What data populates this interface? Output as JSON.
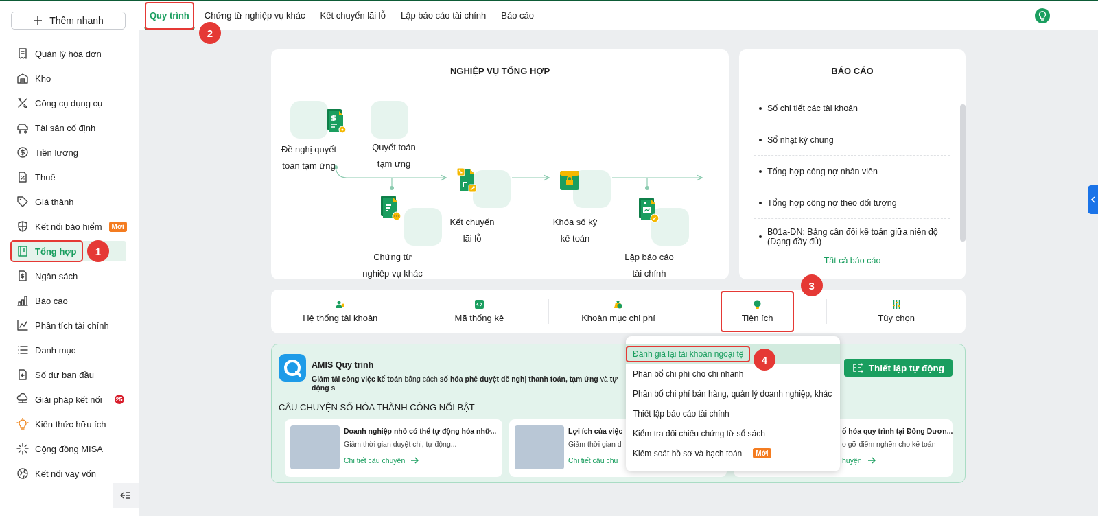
{
  "sidebar": {
    "quick_add": "Thêm nhanh",
    "items": [
      {
        "label": "Quản lý hóa đơn",
        "selected": false,
        "framed": false
      },
      {
        "label": "Kho",
        "selected": false,
        "framed": false
      },
      {
        "label": "Công cụ dụng cụ",
        "selected": false,
        "framed": false
      },
      {
        "label": "Tài sản cố định",
        "selected": false,
        "framed": false
      },
      {
        "label": "Tiền lương",
        "selected": false,
        "framed": false
      },
      {
        "label": "Thuế",
        "selected": false,
        "framed": false
      },
      {
        "label": "Giá thành",
        "selected": false,
        "framed": false
      },
      {
        "label": "Kết nối bảo hiểm",
        "selected": false,
        "framed": false,
        "badge": {
          "kind": "new",
          "text": "Mới"
        }
      },
      {
        "label": "Tổng hợp",
        "selected": true,
        "framed": true,
        "callout": "1"
      },
      {
        "label": "Ngân sách",
        "selected": false,
        "framed": false
      },
      {
        "label": "Báo cáo",
        "selected": false,
        "framed": false
      },
      {
        "label": "Phân tích tài chính",
        "selected": false,
        "framed": false
      },
      {
        "label": "Danh mục",
        "selected": false,
        "framed": false
      },
      {
        "label": "Số dư ban đầu",
        "selected": false,
        "framed": false
      },
      {
        "label": "Giải pháp kết nối",
        "selected": false,
        "framed": false,
        "badge": {
          "kind": "count",
          "text": "25"
        }
      },
      {
        "label": "Kiến thức hữu ích",
        "selected": false,
        "framed": false
      },
      {
        "label": "Cộng đồng MISA",
        "selected": false,
        "framed": false
      },
      {
        "label": "Kết nối vay vốn",
        "selected": false,
        "framed": false
      }
    ]
  },
  "tabs": [
    {
      "label": "Quy trình",
      "selected": true,
      "framed": true,
      "callout": "2"
    },
    {
      "label": "Chứng từ nghiệp vụ khác",
      "selected": false,
      "framed": false
    },
    {
      "label": "Kết chuyển lãi lỗ",
      "selected": false,
      "framed": false
    },
    {
      "label": "Lập báo cáo tài chính",
      "selected": false,
      "framed": false
    },
    {
      "label": "Báo cáo",
      "selected": false,
      "framed": false
    }
  ],
  "process": {
    "title": "NGHIỆP VỤ TỔNG HỢP",
    "steps": [
      {
        "label": "Đề nghị quyết\ntoán tạm ứng"
      },
      {
        "label": "Quyết toán\ntạm ứng"
      },
      {
        "label": "Chứng từ\nnghiệp vụ khác"
      },
      {
        "label": "Kết chuyển\nlãi lỗ"
      },
      {
        "label": "Khóa sổ kỳ\nkế toán"
      },
      {
        "label": "Lập báo cáo\ntài chính"
      }
    ]
  },
  "reports": {
    "title": "BÁO CÁO",
    "items": [
      "Sổ chi tiết các tài khoản",
      "Sổ nhật ký chung",
      "Tổng hợp công nợ nhân viên",
      "Tổng hợp công nợ theo đối tượng",
      "B01a-DN: Bảng cân đối kế toán giữa niên độ (Dạng đầy đủ)"
    ],
    "all_link": "Tất cả báo cáo"
  },
  "tools": [
    {
      "label": "Hệ thống tài khoản",
      "framed": false
    },
    {
      "label": "Mã thống kê",
      "framed": false
    },
    {
      "label": "Khoản mục chi phí",
      "framed": false
    },
    {
      "label": "Tiện ích",
      "framed": true,
      "callout": "3"
    },
    {
      "label": "Tùy chọn",
      "framed": false
    }
  ],
  "dropdown": {
    "items": [
      {
        "label": "Đánh giá lại tài khoản ngoại tệ",
        "selected": true,
        "framed": true,
        "callout": "4"
      },
      {
        "label": "Phân bổ chi phí cho chi nhánh",
        "selected": false,
        "framed": false
      },
      {
        "label": "Phân bổ chi phí bán hàng, quản lý doanh nghiệp, khác",
        "selected": false,
        "framed": false
      },
      {
        "label": "Thiết lập báo cáo tài chính",
        "selected": false,
        "framed": false
      },
      {
        "label": "Kiểm tra đối chiếu chứng từ sổ sách",
        "selected": false,
        "framed": false
      },
      {
        "label": "Kiểm soát hồ sơ và hạch toán",
        "selected": false,
        "framed": false,
        "badge": "Mới"
      }
    ]
  },
  "promo": {
    "title": "AMIS Quy trình",
    "description": "**Giảm tải công việc kế toán** bằng cách **số hóa phê duyệt đề nghị thanh toán, tạm ứng** và **tự động s**",
    "button": "Thiết lập tự động",
    "stories_title": "CÂU CHUYỆN SỐ HÓA THÀNH CÔNG NỔI BẬT",
    "stories": [
      {
        "image": true,
        "title": "Doanh nghiệp nhỏ có thể tự động hóa nhữ...",
        "summary": "Giảm thời gian duyệt chi, tự động...",
        "link": "Chi tiết câu chuyện",
        "arrow": true
      },
      {
        "image": true,
        "title": "Lợi ích của việc",
        "summary": "Giảm thời gian d",
        "link": "Chi tiết câu chu",
        "arrow": false
      },
      {
        "image": false,
        "title": "ố hóa quy trình tại Đông Dươn...",
        "summary": "o gỡ điểm nghẽn cho kế toán",
        "link": "huyện",
        "arrow": true
      }
    ]
  }
}
